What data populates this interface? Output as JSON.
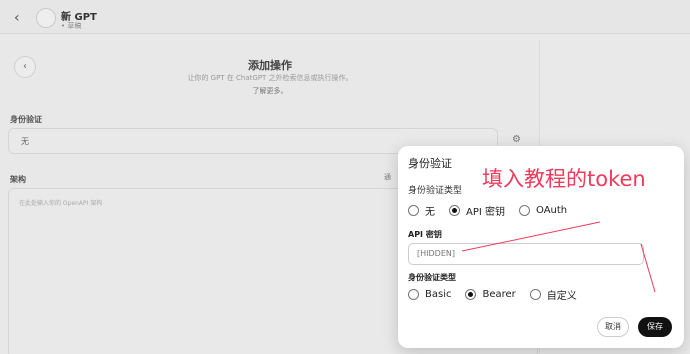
{
  "header": {
    "title": "新 GPT",
    "subtitle": "• 草稿"
  },
  "page": {
    "title": "添加操作",
    "description": "让你的 GPT 在 ChatGPT 之外检索信息或执行操作。",
    "learn_more": "了解更多。"
  },
  "form": {
    "auth_label": "身份验证",
    "auth_value": "无",
    "schema_label": "架构",
    "schema_placeholder": "在此处输入你的 OpenAPI 架构",
    "import_label": "通"
  },
  "modal": {
    "title": "身份验证",
    "auth_type_label": "身份验证类型",
    "auth_types": [
      "无",
      "API 密钥",
      "OAuth"
    ],
    "auth_type_selected": 1,
    "api_key_label": "API 密钥",
    "api_key_value": "[HIDDEN]",
    "scheme_label": "身份验证类型",
    "schemes": [
      "Basic",
      "Bearer",
      "自定义"
    ],
    "scheme_selected": 1,
    "cancel": "取消",
    "save": "保存"
  },
  "annotation": {
    "text": "填入教程的token",
    "color": "#ef3b5b"
  }
}
